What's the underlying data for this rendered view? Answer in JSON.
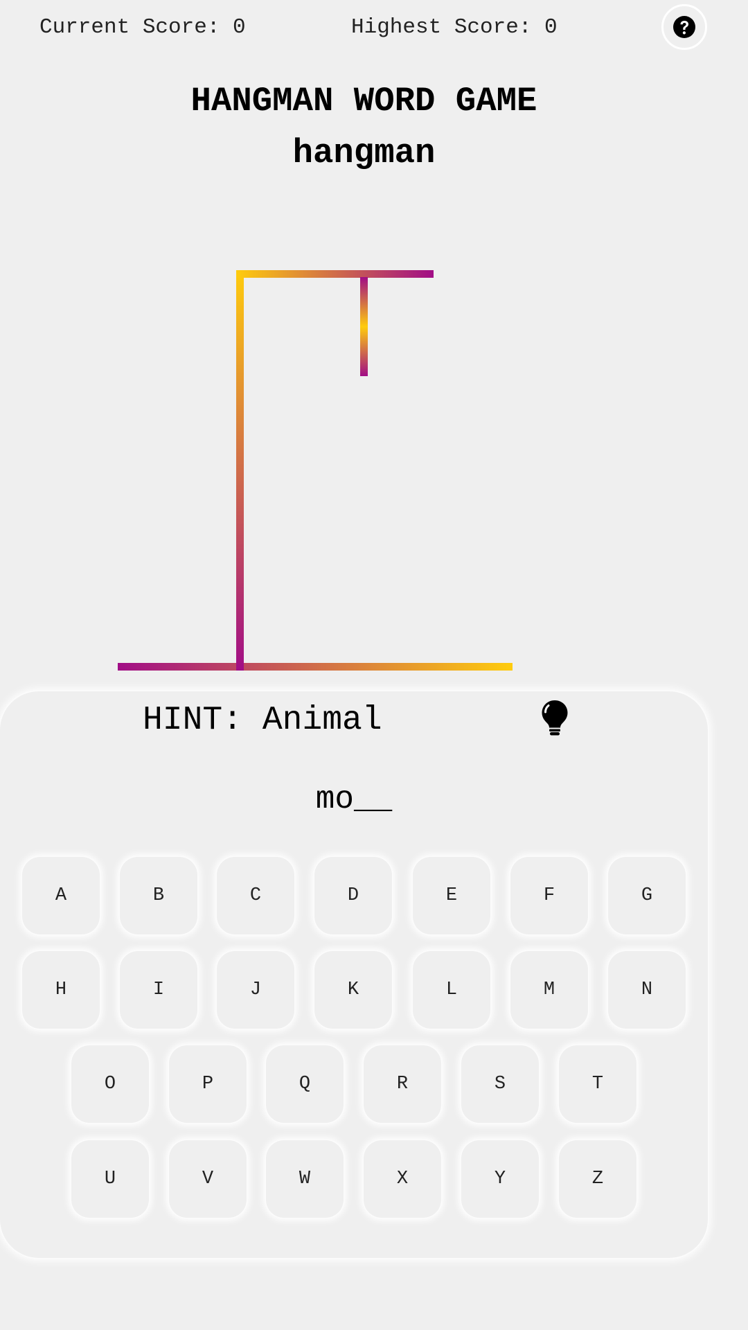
{
  "header": {
    "current_score": "Current Score: 0",
    "highest_score": "Highest Score: 0",
    "help_icon": "question-circle-icon"
  },
  "game": {
    "title": "HANGMAN WORD GAME",
    "subtitle": "hangman",
    "hint": "HINT: Animal",
    "hint_icon": "lightbulb-icon",
    "word_display": "mo__",
    "gradient_colors": [
      "#a10d86",
      "#ffcc0d"
    ]
  },
  "keyboard": {
    "rows": [
      [
        "A",
        "B",
        "C",
        "D",
        "E",
        "F",
        "G"
      ],
      [
        "H",
        "I",
        "J",
        "K",
        "L",
        "M",
        "N"
      ],
      [
        "O",
        "P",
        "Q",
        "R",
        "S",
        "T"
      ],
      [
        "U",
        "V",
        "W",
        "X",
        "Y",
        "Z"
      ]
    ]
  }
}
